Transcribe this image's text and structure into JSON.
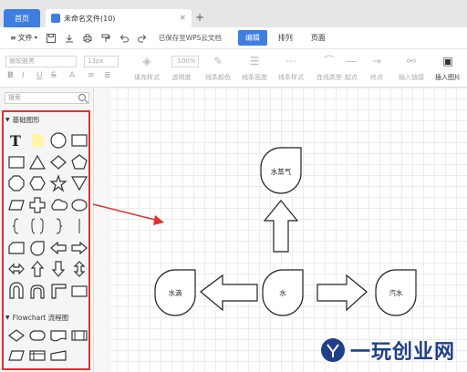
{
  "tabs": {
    "home": "首页",
    "file": "未命名文件(10)",
    "close": "×",
    "add": "+"
  },
  "menu": {
    "file_label": "文件",
    "cloud_status": "已保存至WPS云文档",
    "tabs": [
      "编辑",
      "排列",
      "页面"
    ],
    "active_tab": "编辑"
  },
  "toolbar": {
    "font_name": "微软雅黑",
    "font_size": "13px",
    "zoom": "100%",
    "format_buttons": [
      "B",
      "I",
      "U",
      "S"
    ],
    "tools": [
      {
        "label": "填充样式",
        "icon": "paint-bucket-icon"
      },
      {
        "label": "透明度",
        "icon": "opacity-icon"
      },
      {
        "label": "线条颜色",
        "icon": "pen-icon"
      },
      {
        "label": "线条宽度",
        "icon": "line-width-icon"
      },
      {
        "label": "线条样式",
        "icon": "line-style-icon"
      },
      {
        "label": "连线类型",
        "icon": "connector-icon"
      },
      {
        "label": "起点",
        "icon": "line-start-icon"
      },
      {
        "label": "终点",
        "icon": "arrow-end-icon"
      },
      {
        "label": "插入链接",
        "icon": "link-icon"
      },
      {
        "label": "插入图片",
        "icon": "image-icon"
      }
    ]
  },
  "sidebar": {
    "search_placeholder": "搜索",
    "sections": [
      {
        "title": "基础图形"
      },
      {
        "title": "Flowchart 流程图"
      }
    ]
  },
  "diagram": {
    "nodes": [
      "水蒸气",
      "水滴",
      "水",
      "汽水"
    ]
  },
  "watermark": {
    "text": "一玩创业网"
  },
  "colors": {
    "accent": "#3d7ee0",
    "highlight": "#e03030",
    "watermark": "#1f3f8a"
  }
}
